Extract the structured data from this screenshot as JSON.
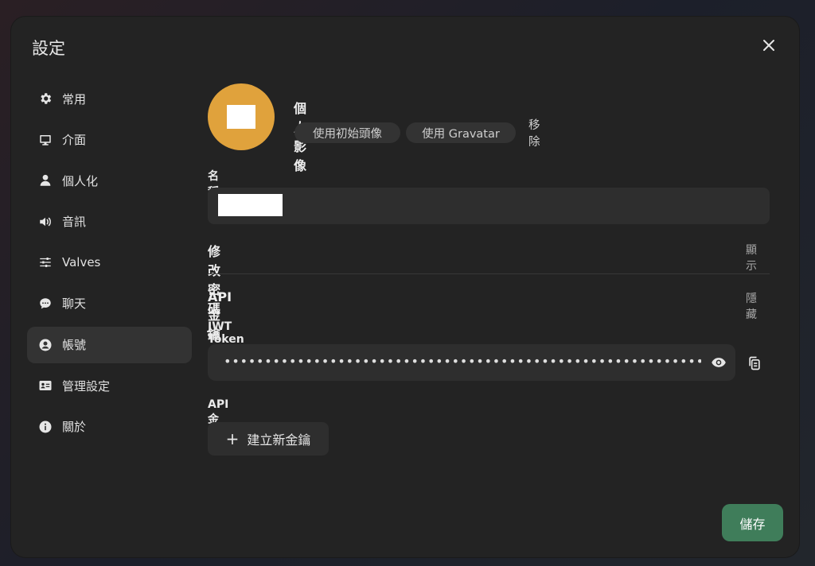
{
  "dialog": {
    "title": "設定",
    "close_icon": "close-icon"
  },
  "sidebar": {
    "items": [
      {
        "label": "常用",
        "icon": "gear-icon",
        "active": false
      },
      {
        "label": "介面",
        "icon": "monitor-icon",
        "active": false
      },
      {
        "label": "個人化",
        "icon": "user-icon",
        "active": false
      },
      {
        "label": "音訊",
        "icon": "speaker-icon",
        "active": false
      },
      {
        "label": "Valves",
        "icon": "sliders-icon",
        "active": false
      },
      {
        "label": "聊天",
        "icon": "chat-bubble-icon",
        "active": false
      },
      {
        "label": "帳號",
        "icon": "user-circle-icon",
        "active": true
      },
      {
        "label": "管理設定",
        "icon": "id-card-icon",
        "active": false
      },
      {
        "label": "關於",
        "icon": "info-icon",
        "active": false
      }
    ]
  },
  "account": {
    "profile_label": "個人影像",
    "use_initials": "使用初始頭像",
    "use_gravatar": "使用 Gravatar",
    "remove": "移除",
    "avatar_color": "#e0a23c",
    "name_label": "名稱",
    "change_password_label": "修改密碼",
    "change_password_action": "顯示",
    "api_keys_label": "API 金鑰",
    "api_keys_action": "隱藏",
    "jwt_label": "JWT Token",
    "jwt_value": "•••••••••••••••••••••••••••••••••••••••••••••••••••••••••••••",
    "api_key_label": "API 金鑰",
    "create_key": "建立新金鑰",
    "save": "儲存",
    "save_color": "#3f7d5a"
  }
}
